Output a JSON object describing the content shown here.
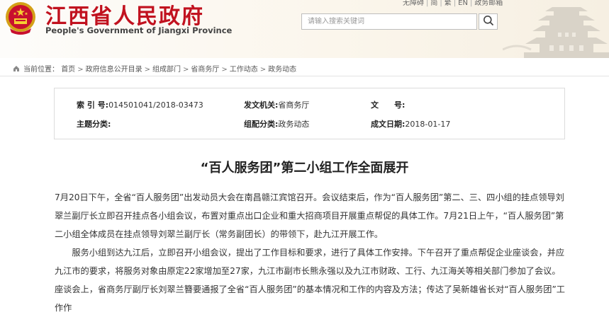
{
  "header": {
    "site_title": "江西省人民政府",
    "site_subtitle": "People's Government of Jiangxi Province",
    "emblem_icon": "national-emblem-icon",
    "top_links": [
      "无障碍",
      "简",
      "繁",
      "EN",
      "政务邮箱"
    ],
    "search_placeholder": "请输入搜索关键词",
    "search_icon": "search-icon",
    "brand_color": "#c1121f"
  },
  "breadcrumb": {
    "label": "当前位置：",
    "items": [
      "首页",
      "政府信息公开目录",
      "组成部门",
      "省商务厅",
      "工作动态",
      "政务动态"
    ],
    "separator": ">"
  },
  "meta": {
    "index_label": "索 引 号:",
    "index_value": "014501041/2018-03473",
    "agency_label": "发文机关:",
    "agency_value": "省商务厅",
    "docno_label": "文　　号:",
    "docno_value": "",
    "topic_label": "主题分类:",
    "topic_value": "",
    "org_label": "组配分类:",
    "org_value": "政务动态",
    "date_label": "成文日期:",
    "date_value": "2018-01-17"
  },
  "article": {
    "title": "“百人服务团”第二小组工作全面展开",
    "paragraphs": [
      "7月20日下午，全省“百人服务团”出发动员大会在南昌赣江宾馆召开。会议结束后，作为“百人服务团”第二、三、四小组的挂点领导刘翠兰副厅长立即召开挂点各小组会议，布置对重点出口企业和重大招商项目开展重点帮促的具体工作。7月21日上午，“百人服务团”第二小组全体成员在挂点领导刘翠兰副厅长（常务副团长）的带领下，赴九江开展工作。",
      "服务小组到达九江后，立即召开小组会议，提出了工作目标和要求，进行了具体工作安排。下午召开了重点帮促企业座谈会，并应九江市的要求，将服务对象由原定22家增加至27家，九江市副市长熊永强以及九江市财政、工行、九江海关等相关部门参加了会议。座谈会上，省商务厅副厅长刘翠兰簪要通报了全省“百人服务团”的基本情况和工作的内容及方法；传达了吴新雄省长对“百人服务团”工作作"
    ]
  }
}
